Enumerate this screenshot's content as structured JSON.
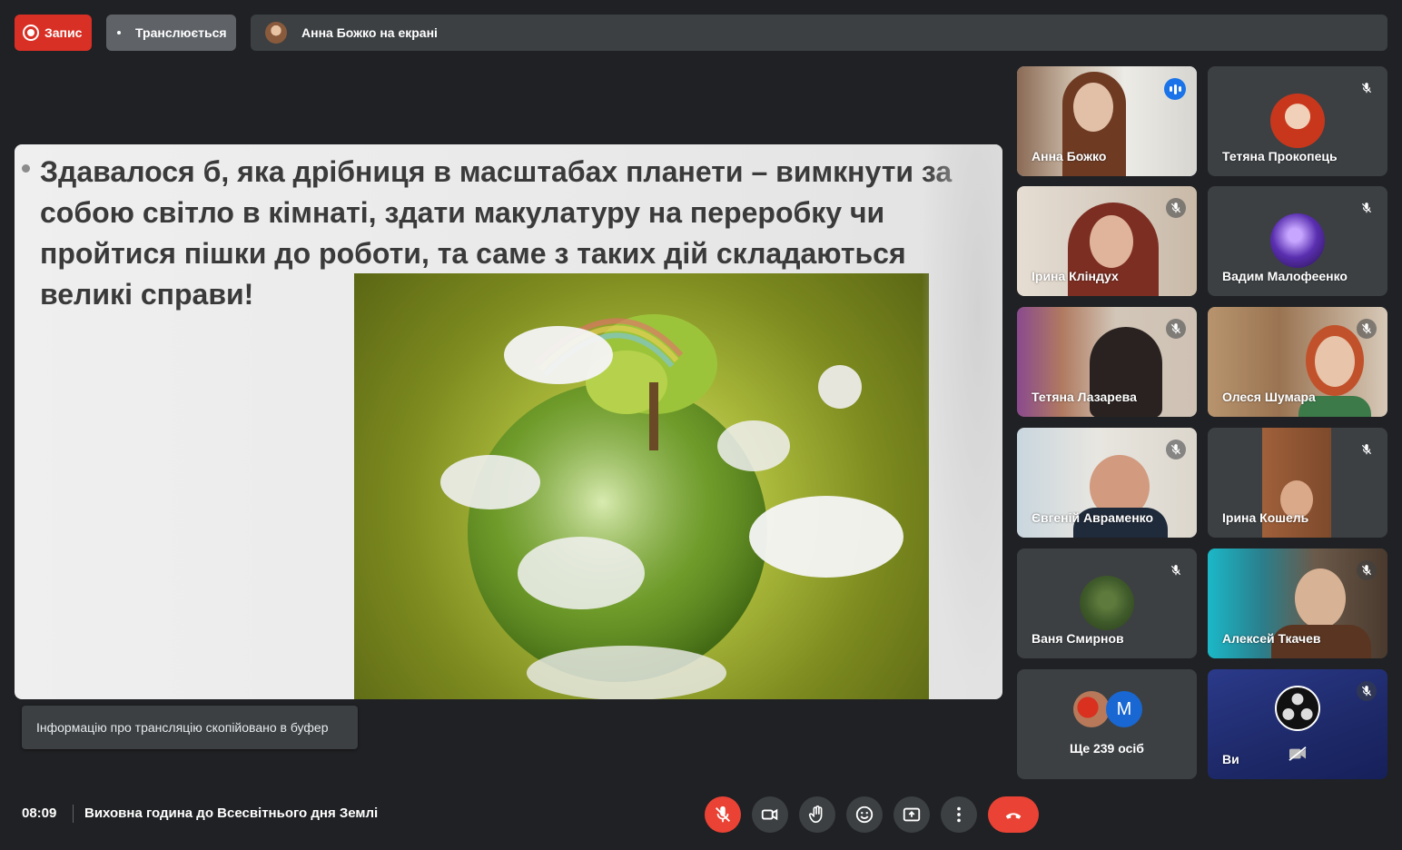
{
  "topbar": {
    "record_label": "Запис",
    "broadcast_label": "Транслюється",
    "presenter_label": "Анна Божко на екрані"
  },
  "slide": {
    "text": "Здавалося б, яка дрібниця в масштабах планети – вимкнути за собою світло в кімнаті, здати макулатуру на переробку чи пройтися пішки до роботи, та саме з таких дій складаються великі справи!"
  },
  "toast": {
    "text": "Інформацію про трансляцію скопійовано в буфер"
  },
  "participants": [
    {
      "name": "Анна Божко",
      "state": "speaking"
    },
    {
      "name": "Тетяна Прокопець",
      "state": "muted"
    },
    {
      "name": "Ірина Кліндух",
      "state": "muted"
    },
    {
      "name": "Вадим Малофеенко",
      "state": "muted"
    },
    {
      "name": "Тетяна Лазарева",
      "state": "muted"
    },
    {
      "name": "Олеся Шумара",
      "state": "muted"
    },
    {
      "name": "Євгеній Авраменко",
      "state": "muted"
    },
    {
      "name": "Ірина Кошель",
      "state": "muted"
    },
    {
      "name": "Ваня Смирнов",
      "state": "muted"
    },
    {
      "name": "Алексей Ткачев",
      "state": "muted"
    },
    {
      "name": "Ви",
      "state": "muted"
    }
  ],
  "more": {
    "avatar_letter": "M",
    "label": "Ще 239 осіб"
  },
  "bottombar": {
    "time": "08:09",
    "meeting_title": "Виховна година до Всесвітнього дня Землі"
  },
  "colors": {
    "record": "#d93025",
    "end_call": "#ea4335",
    "speaking": "#1a73e8",
    "background": "#202124",
    "tile": "#3c4043"
  }
}
